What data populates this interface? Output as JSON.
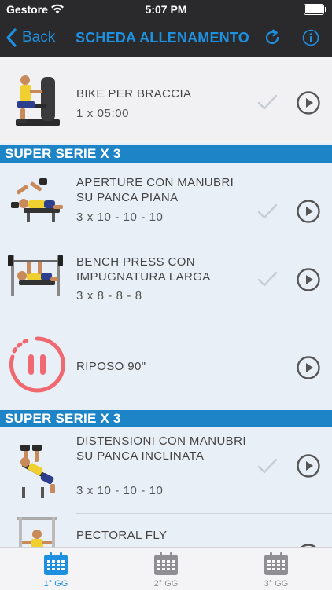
{
  "status": {
    "carrier": "Gestore",
    "time": "5:07 PM"
  },
  "nav": {
    "back_label": "Back",
    "title": "SCHEDA ALLENAMENTO"
  },
  "list": {
    "rows": [
      {
        "name": "BIKE PER BRACCIA",
        "reps": "1 x 05:00"
      },
      {
        "section": "SUPER SERIE X 3"
      },
      {
        "name": "APERTURE CON MANUBRI SU PANCA PIANA",
        "reps": "3 x 10 - 10 - 10"
      },
      {
        "name": "BENCH PRESS CON IMPUGNATURA LARGA",
        "reps": "3 x 8 - 8 - 8"
      },
      {
        "name": "RIPOSO 90\""
      },
      {
        "section": "SUPER SERIE X 3"
      },
      {
        "name": "DISTENSIONI CON MANUBRI SU PANCA INCLINATA",
        "reps": "3 x 10 - 10 - 10"
      },
      {
        "name": "PECTORAL FLY"
      }
    ]
  },
  "tabbar": {
    "tabs": [
      {
        "label": "1° GG",
        "active": true
      },
      {
        "label": "2° GG",
        "active": false
      },
      {
        "label": "3° GG",
        "active": false
      }
    ]
  },
  "colors": {
    "accent": "#1e90e0",
    "section_bg": "#1d84c8",
    "row_bg": "#e9eff7",
    "rest_red": "#f06870",
    "nav_bg": "#2a2a2c"
  },
  "icons": [
    "wifi-icon",
    "battery-icon",
    "back-chevron-icon",
    "refresh-icon",
    "info-icon",
    "check-icon",
    "play-icon",
    "pause-timer-icon",
    "calendar-icon"
  ]
}
